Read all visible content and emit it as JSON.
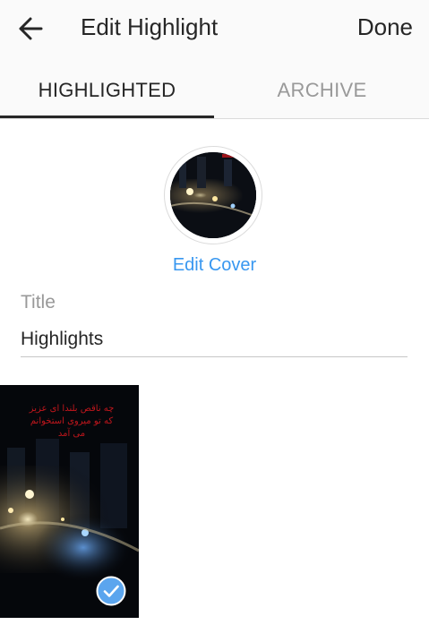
{
  "header": {
    "title": "Edit Highlight",
    "done_label": "Done",
    "back_icon": "arrow-left-icon"
  },
  "tabs": [
    {
      "label": "HIGHLIGHTED",
      "active": true
    },
    {
      "label": "ARCHIVE",
      "active": false
    }
  ],
  "cover": {
    "edit_label": "Edit Cover"
  },
  "title_field": {
    "label": "Title",
    "value": "Highlights"
  },
  "stories": [
    {
      "caption": "چه ناقص بلندا ای عزیز که تو میروی استخوانم می آمد",
      "selected": true
    }
  ],
  "colors": {
    "accent": "#3897f0",
    "text": "#262626",
    "muted": "#999999",
    "check": "#5ba5ee"
  }
}
